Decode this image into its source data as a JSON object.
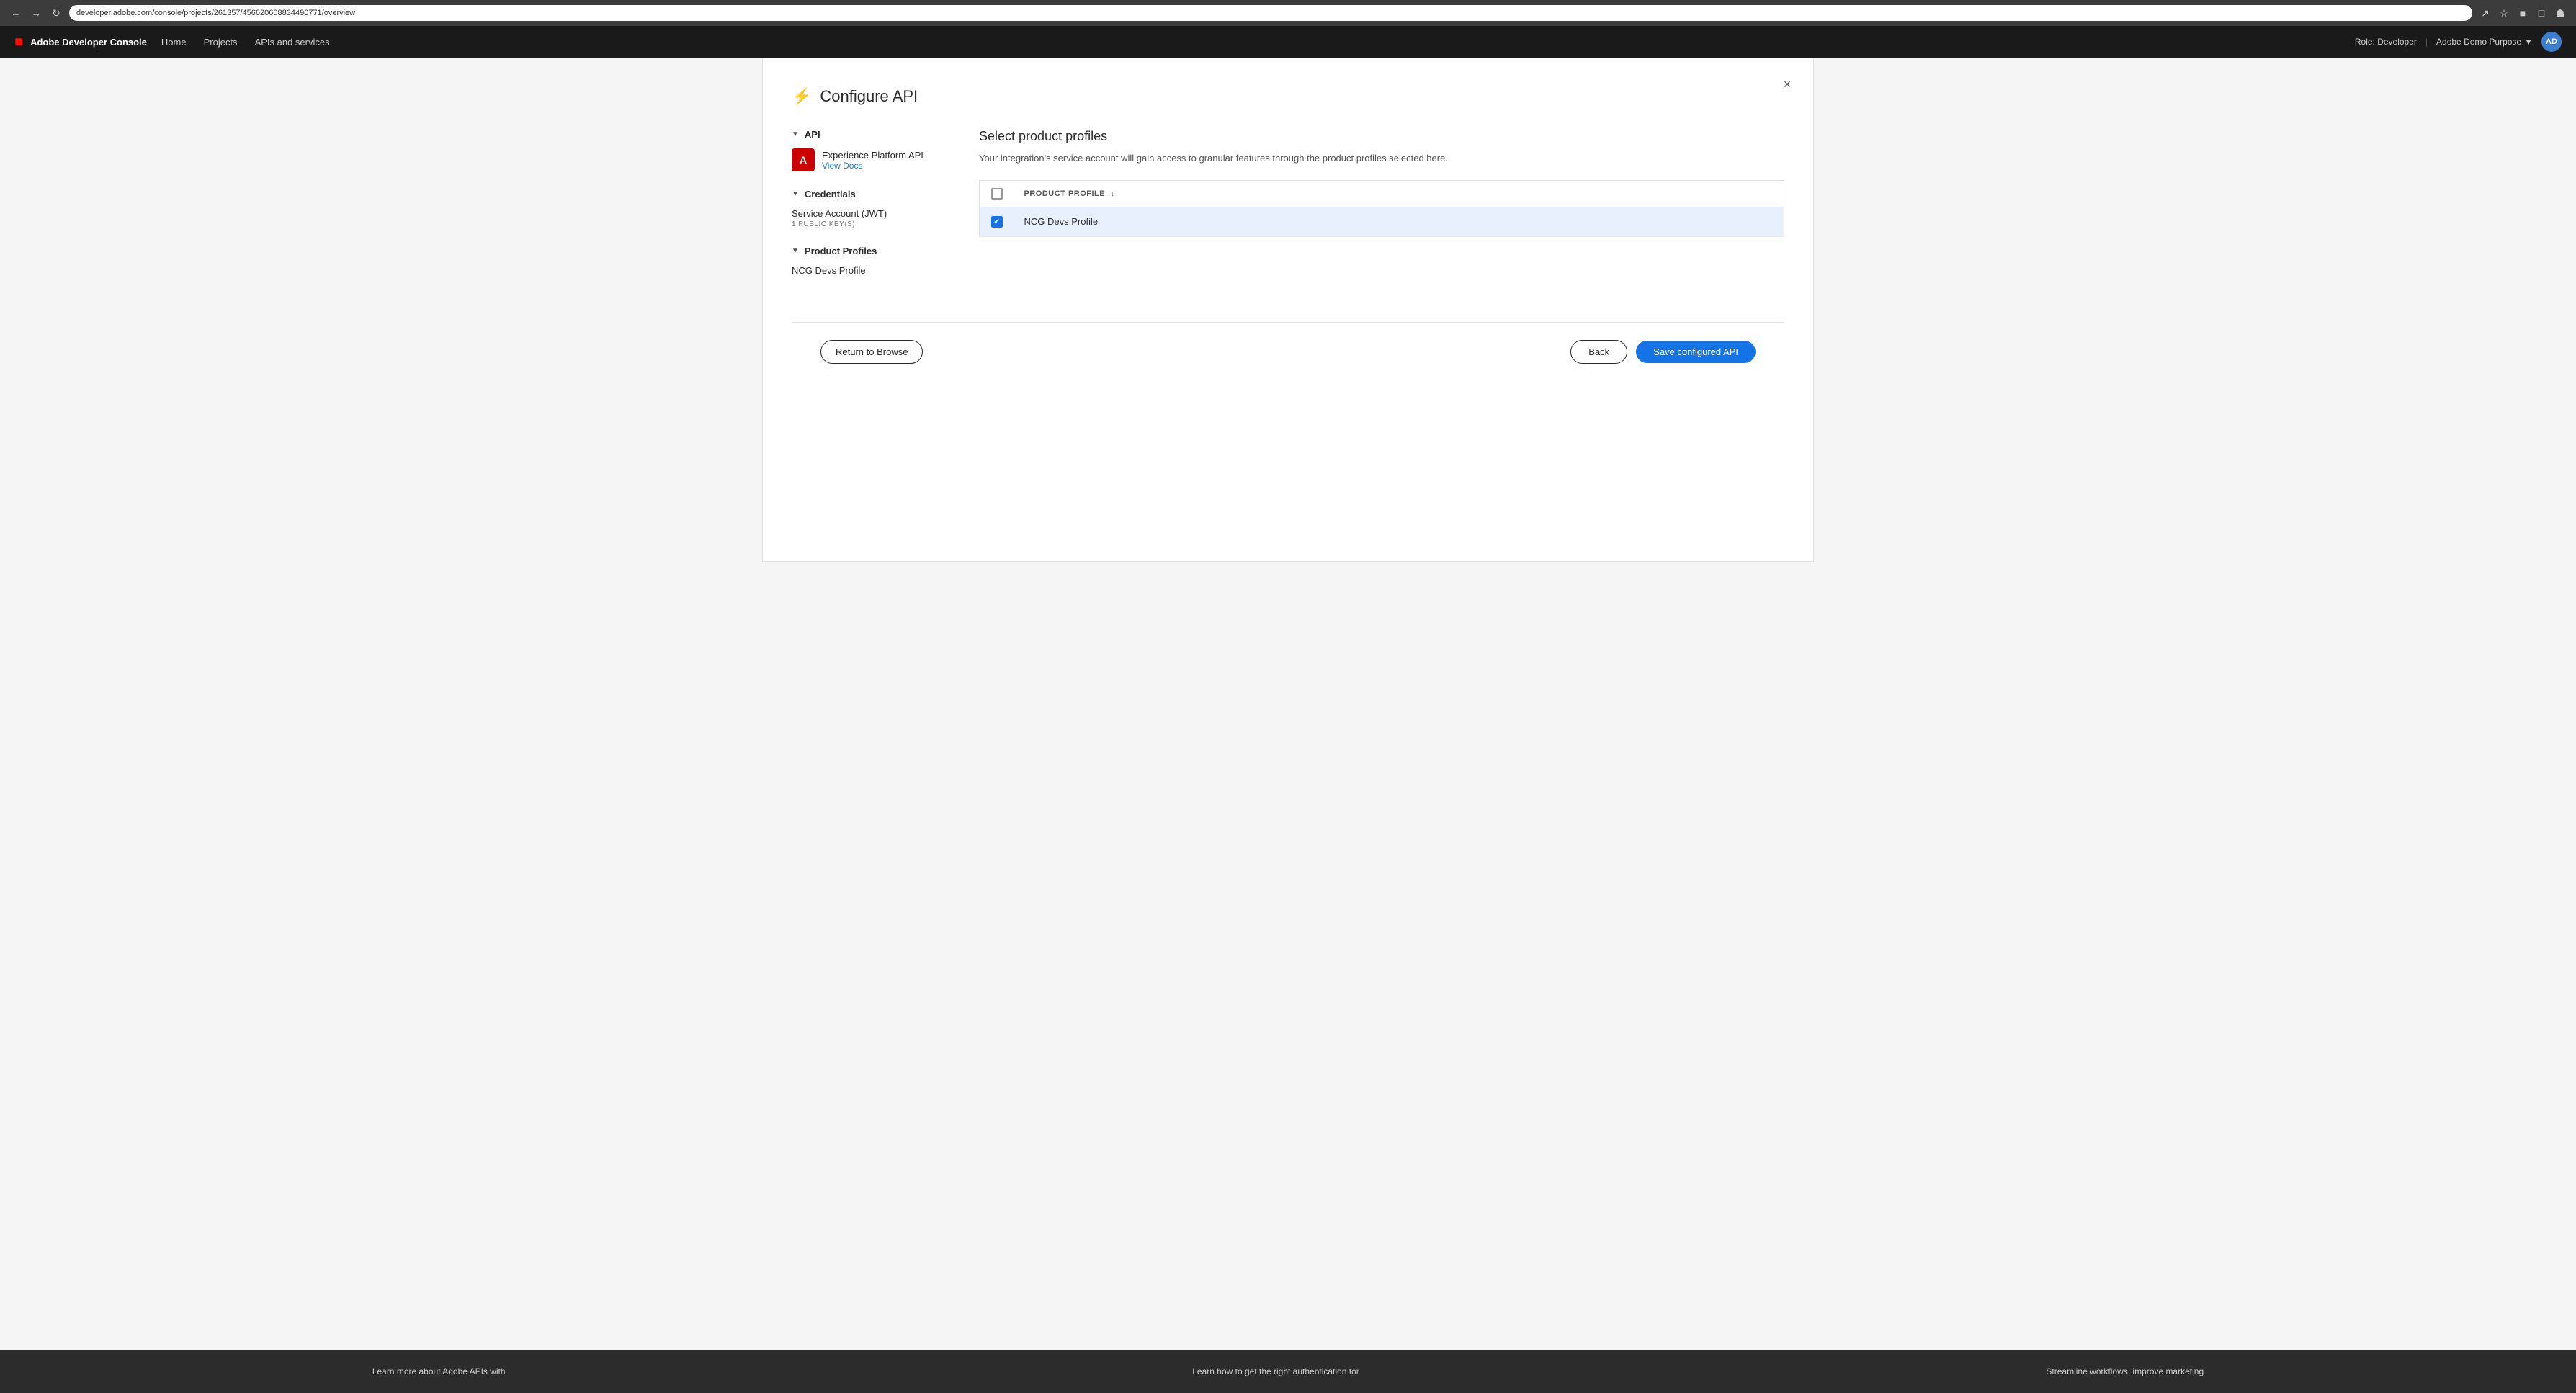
{
  "browser": {
    "url": "developer.adobe.com/console/projects/261357/456620608834490771/overview",
    "nav_buttons": [
      "←",
      "→",
      "↻"
    ]
  },
  "adobe_nav": {
    "logo_text": "A",
    "brand": "Adobe Developer Console",
    "links": [
      "Home",
      "Projects",
      "APIs and services"
    ],
    "role_label": "Role: Developer",
    "org_label": "Adobe Demo Purpose",
    "avatar_initials": "AD"
  },
  "modal": {
    "title": "Configure API",
    "title_icon": "⚡",
    "close_label": "×",
    "sidebar": {
      "api_section_label": "API",
      "api_name": "Experience Platform API",
      "api_view_docs": "View Docs",
      "credentials_section_label": "Credentials",
      "service_account_name": "Service Account (JWT)",
      "service_account_sub": "1 PUBLIC KEY(S)",
      "product_profiles_section_label": "Product Profiles",
      "ncg_devs_profile": "NCG Devs Profile"
    },
    "content": {
      "section_title": "Select product profiles",
      "description": "Your integration's service account will gain access to granular features through the product profiles selected here.",
      "table": {
        "column_header": "PRODUCT PROFILE",
        "rows": [
          {
            "name": "NCG Devs Profile",
            "checked": true
          }
        ]
      }
    },
    "footer": {
      "return_browse_label": "Return to Browse",
      "back_label": "Back",
      "save_label": "Save configured API"
    }
  },
  "teaser": {
    "items": [
      "Learn more about Adobe APIs with",
      "Learn how to get the right authentication for",
      "Streamline workflows, improve marketing"
    ]
  }
}
